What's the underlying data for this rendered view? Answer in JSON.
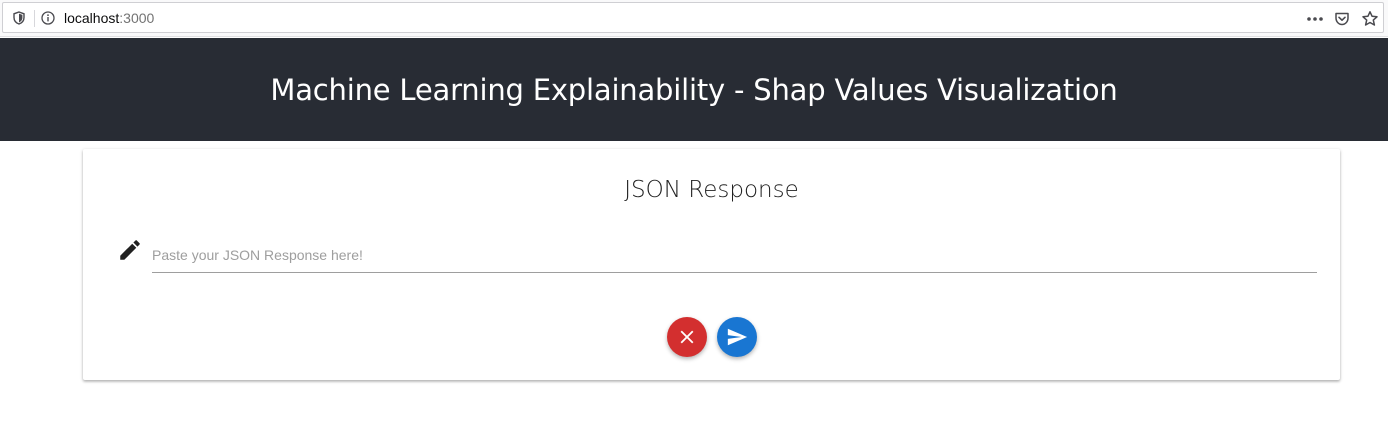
{
  "browser": {
    "url_host": "localhost",
    "url_port": ":3000",
    "icons": [
      "shield-icon",
      "info-icon",
      "more-dots-icon",
      "pocket-icon",
      "bookmark-star-icon"
    ]
  },
  "header": {
    "title": "Machine Learning Explainability - Shap Values Visualization",
    "background": "#282c34"
  },
  "card": {
    "title": "JSON Response",
    "input": {
      "value": "",
      "placeholder": "Paste your JSON Response here!",
      "icon": "pencil-icon"
    },
    "buttons": {
      "clear": {
        "icon": "close-icon",
        "color": "#d32f2f"
      },
      "send": {
        "icon": "send-icon",
        "color": "#1976d2"
      }
    }
  }
}
